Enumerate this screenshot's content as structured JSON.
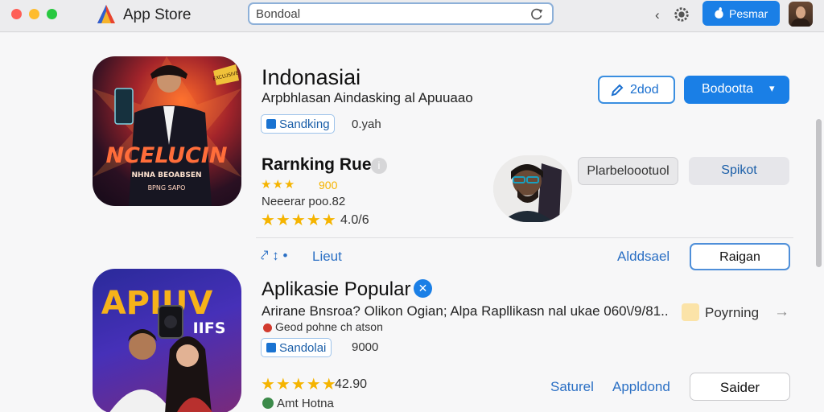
{
  "window": {
    "app_name": "App Store",
    "search_value": "Bondoal"
  },
  "toolbar": {
    "back_glyph": "‹",
    "store_button_label": "Pesmar"
  },
  "app1": {
    "icon_text_main": "NCELUCIN",
    "icon_text_sub": "NHNA BEOABSEN",
    "icon_text_small": "BPNG SAPO",
    "icon_corner_tag": "EXCLUSIVE",
    "title": "Indonasiai",
    "subtitle": "Arpbhlasan Aindasking al Apuuaao",
    "badge_label": "Sandking",
    "size": "0.yah",
    "secondary_button": "2dod",
    "primary_button": "Bodootta",
    "primary_chevron": "▾"
  },
  "ranking": {
    "title": "Rarnking Rues",
    "info_glyph": "i",
    "star_text": "★★★ 900",
    "stars_small": "★★★",
    "stars_small_value": "900",
    "near_text": "Neeerar poo.82",
    "stars_big": "★★★★★",
    "rating_value": "4.0/6",
    "pill_button": "Plarbeloootuol",
    "blue_pill_button": "Spikot"
  },
  "row_actions": {
    "icon_cluster": "⤤ ↕ •",
    "list_link": "Lieut",
    "added_link": "Alddsael",
    "raigan_button": "Raigan"
  },
  "app2": {
    "icon_text_main": "APIUV",
    "icon_text_side": "IIFS",
    "title": "Aplikasie Popular",
    "description": "Arirane Bnsroa? Olikon Ogian; Alpa Rapllikasn nal ukae 060\\/9/81..",
    "status_text": "Geod pohne ch atson",
    "badge_label": "Sandolai",
    "count": "9000",
    "paying_label": "Poyrning",
    "stars": "★★★★★",
    "rating_value": "42.90",
    "author": "Amt Hotna",
    "link_1": "Saturel",
    "link_2": "Appldond",
    "saider_button": "Saider",
    "arrow": "→"
  },
  "colors": {
    "accent": "#1a7fe6",
    "star": "#f5b400",
    "link": "#2a6fc4"
  }
}
